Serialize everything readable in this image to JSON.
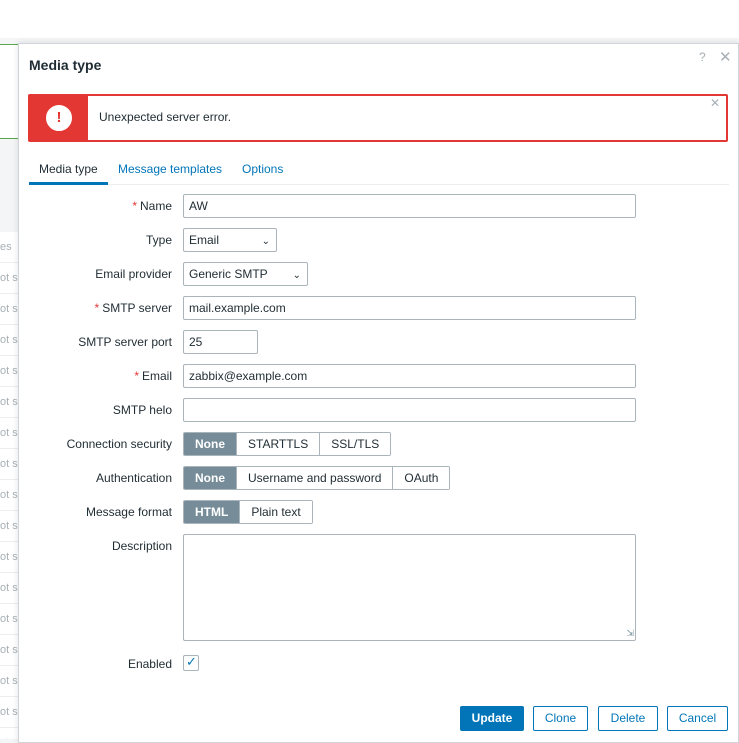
{
  "background": {
    "list_items": [
      "ot s",
      "ot s",
      "ot s",
      "ot s",
      "ot s",
      "ot s",
      "ot s",
      "ot s",
      "ot s",
      "ot s",
      "ot s",
      "ot s",
      "ot s",
      "ot s",
      "ot s",
      "ot s"
    ],
    "partial_label": "es"
  },
  "dialog": {
    "title": "Media type",
    "help_icon": "?",
    "close_icon": "✕"
  },
  "error": {
    "message": "Unexpected server error.",
    "icon": "!",
    "close_icon": "✕"
  },
  "tabs": [
    {
      "label": "Media type",
      "active": true
    },
    {
      "label": "Message templates",
      "active": false
    },
    {
      "label": "Options",
      "active": false
    }
  ],
  "form": {
    "name": {
      "label": "Name",
      "value": "AW",
      "required": true
    },
    "type": {
      "label": "Type",
      "value": "Email"
    },
    "email_provider": {
      "label": "Email provider",
      "value": "Generic SMTP"
    },
    "smtp_server": {
      "label": "SMTP server",
      "value": "mail.example.com",
      "required": true
    },
    "smtp_port": {
      "label": "SMTP server port",
      "value": "25"
    },
    "email": {
      "label": "Email",
      "value": "zabbix@example.com",
      "required": true
    },
    "smtp_helo": {
      "label": "SMTP helo",
      "value": ""
    },
    "connection_security": {
      "label": "Connection security",
      "options": [
        "None",
        "STARTTLS",
        "SSL/TLS"
      ],
      "selected": "None"
    },
    "authentication": {
      "label": "Authentication",
      "options": [
        "None",
        "Username and password",
        "OAuth"
      ],
      "selected": "None"
    },
    "message_format": {
      "label": "Message format",
      "options": [
        "HTML",
        "Plain text"
      ],
      "selected": "HTML"
    },
    "description": {
      "label": "Description",
      "value": ""
    },
    "enabled": {
      "label": "Enabled",
      "checked": true
    }
  },
  "buttons": {
    "update": "Update",
    "clone": "Clone",
    "delete": "Delete",
    "cancel": "Cancel"
  },
  "colors": {
    "accent": "#0275b8",
    "error": "#e33734",
    "segment_on": "#768d99"
  }
}
